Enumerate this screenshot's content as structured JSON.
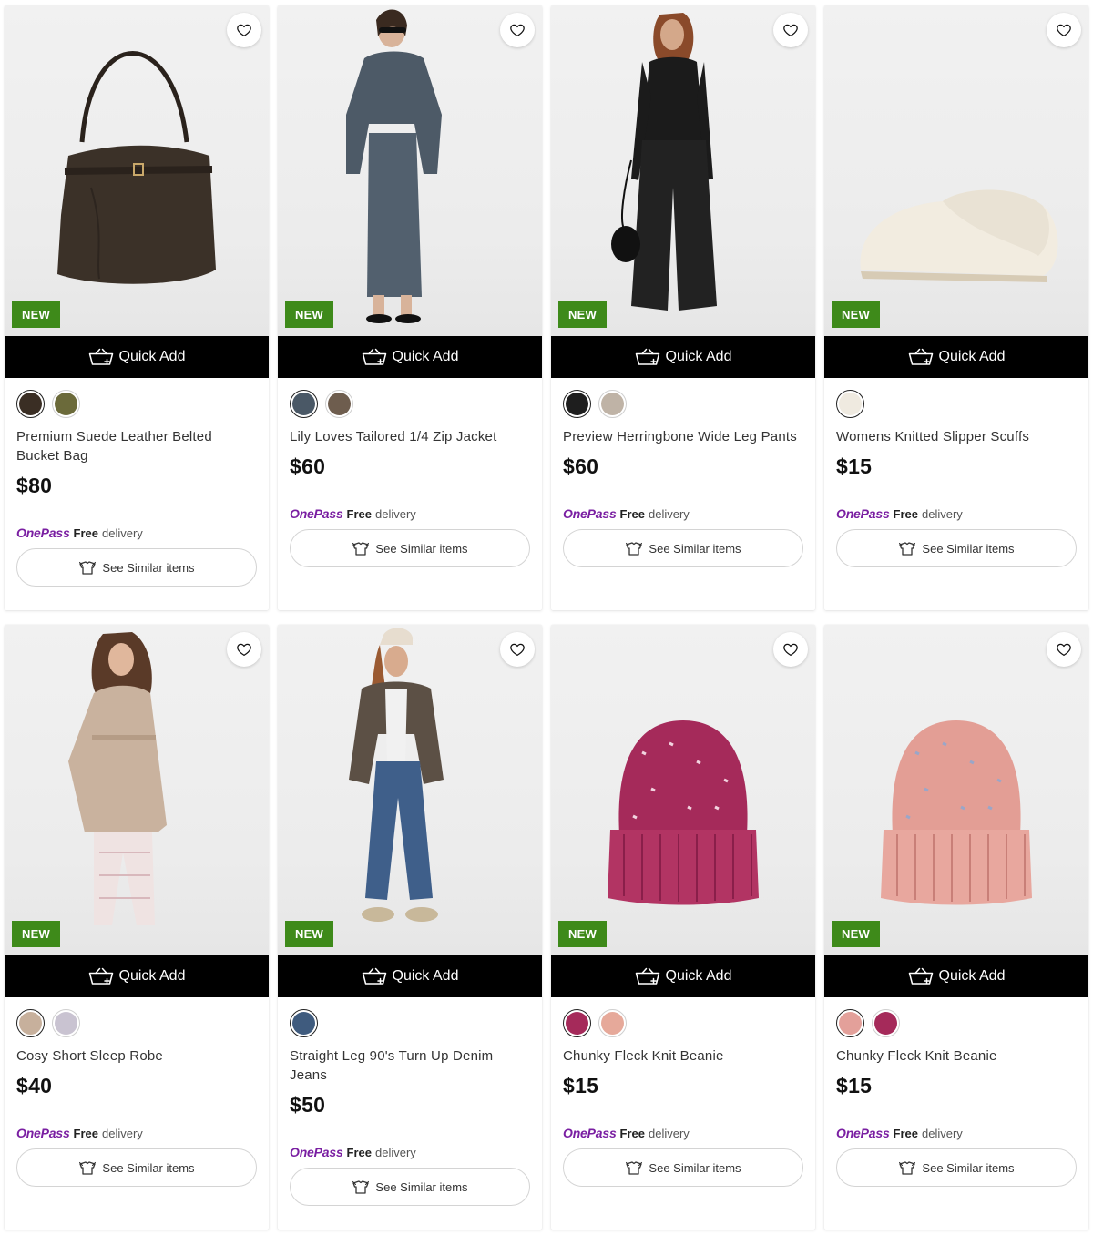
{
  "common": {
    "badge_label": "NEW",
    "quick_add_label": "Quick Add",
    "onepass_label": "OnePass",
    "free_label": "Free",
    "delivery_label": "delivery",
    "see_similar_label": "See Similar items",
    "colors": {
      "badge": "#3e8a1a",
      "onepass": "#7a1fa2",
      "quick_add_bg": "#000000"
    }
  },
  "products": [
    {
      "title": "Premium Suede Leather Belted Bucket Bag",
      "price": "$80",
      "image": "brown-suede-bucket-bag",
      "swatches": [
        "#3a2e24",
        "#6b6a3a"
      ]
    },
    {
      "title": "Lily Loves Tailored 1/4 Zip Jacket",
      "price": "$60",
      "image": "model-blue-grey-zip-jacket-skirt",
      "swatches": [
        "#4a5866",
        "#6e5d4e"
      ]
    },
    {
      "title": "Preview Herringbone Wide Leg Pants",
      "price": "$60",
      "image": "model-black-wide-leg-pants",
      "swatches": [
        "#1e1e1e",
        "#bfb3a6"
      ]
    },
    {
      "title": "Womens Knitted Slipper Scuffs",
      "price": "$15",
      "image": "cream-knit-slipper",
      "swatches": [
        "#efeae0"
      ]
    },
    {
      "title": "Cosy Short Sleep Robe",
      "price": "$40",
      "image": "model-beige-sleep-robe",
      "swatches": [
        "#c7b09c",
        "#c9c3d1"
      ]
    },
    {
      "title": "Straight Leg 90's Turn Up Denim Jeans",
      "price": "$50",
      "image": "model-denim-jeans-blazer",
      "swatches": [
        "#3f5b7e"
      ]
    },
    {
      "title": "Chunky Fleck Knit Beanie",
      "price": "$15",
      "image": "magenta-knit-beanie",
      "swatches": [
        "#a52a5a",
        "#e6a99a"
      ]
    },
    {
      "title": "Chunky Fleck Knit Beanie",
      "price": "$15",
      "image": "pink-knit-beanie",
      "swatches": [
        "#e3a09a",
        "#a52a5a"
      ]
    }
  ]
}
